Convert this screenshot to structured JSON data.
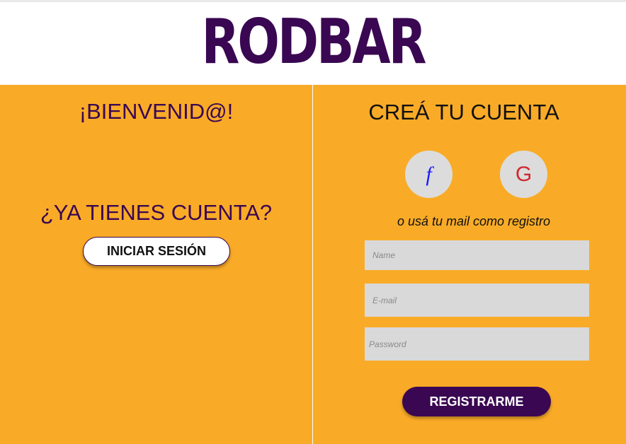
{
  "header": {
    "logo_text": "RODBAR"
  },
  "left": {
    "welcome": "¡BIENVENID@!",
    "question": "¿YA TIENES CUENTA?",
    "login_label": "INICIAR SESIÓN"
  },
  "right": {
    "title": "CREÁ TU CUENTA",
    "facebook_glyph": "f",
    "google_glyph": "G",
    "mail_note": "o usá tu mail como registro",
    "fields": {
      "name_placeholder": "Name",
      "email_placeholder": "E-mail",
      "password_placeholder": "Password"
    },
    "register_label": "REGISTRARME"
  },
  "colors": {
    "brand_purple": "#3a0752",
    "background_orange": "#f9ab27",
    "input_gray": "#d9d9d9",
    "facebook_blue": "#1a1aff",
    "google_red": "#d0282e"
  },
  "icons": [
    "facebook-icon",
    "google-icon"
  ]
}
